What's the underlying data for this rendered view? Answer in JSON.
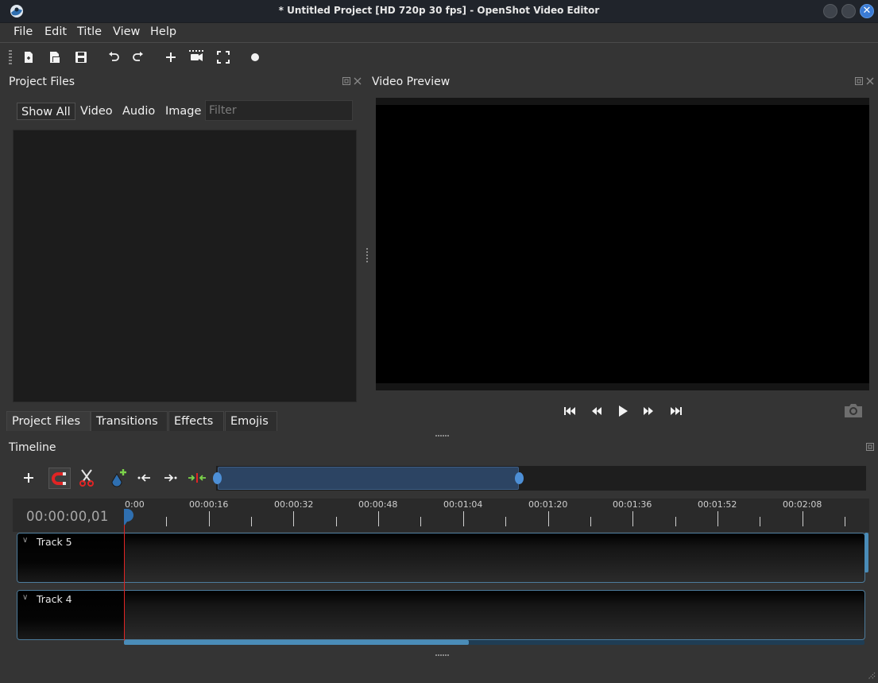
{
  "window": {
    "title": "* Untitled Project [HD 720p 30 fps] - OpenShot Video Editor",
    "close_glyph": "✕"
  },
  "menu": [
    "File",
    "Edit",
    "Title",
    "View",
    "Help"
  ],
  "project_files": {
    "title": "Project Files",
    "filters": [
      "Show All",
      "Video",
      "Audio",
      "Image"
    ],
    "filter_placeholder": "Filter"
  },
  "bottom_tabs": [
    "Project Files",
    "Transitions",
    "Effects",
    "Emojis"
  ],
  "video_preview": {
    "title": "Video Preview"
  },
  "timeline": {
    "title": "Timeline",
    "current_time": "00:00:00,01",
    "tick_labels": [
      "0:00",
      "00:00:16",
      "00:00:32",
      "00:00:48",
      "00:01:04",
      "00:01:20",
      "00:01:36",
      "00:01:52",
      "00:02:08"
    ],
    "tracks": [
      "Track 5",
      "Track 4"
    ]
  },
  "colors": {
    "accent": "#4a8cb8",
    "playhead": "#e02424",
    "background": "#343434"
  }
}
